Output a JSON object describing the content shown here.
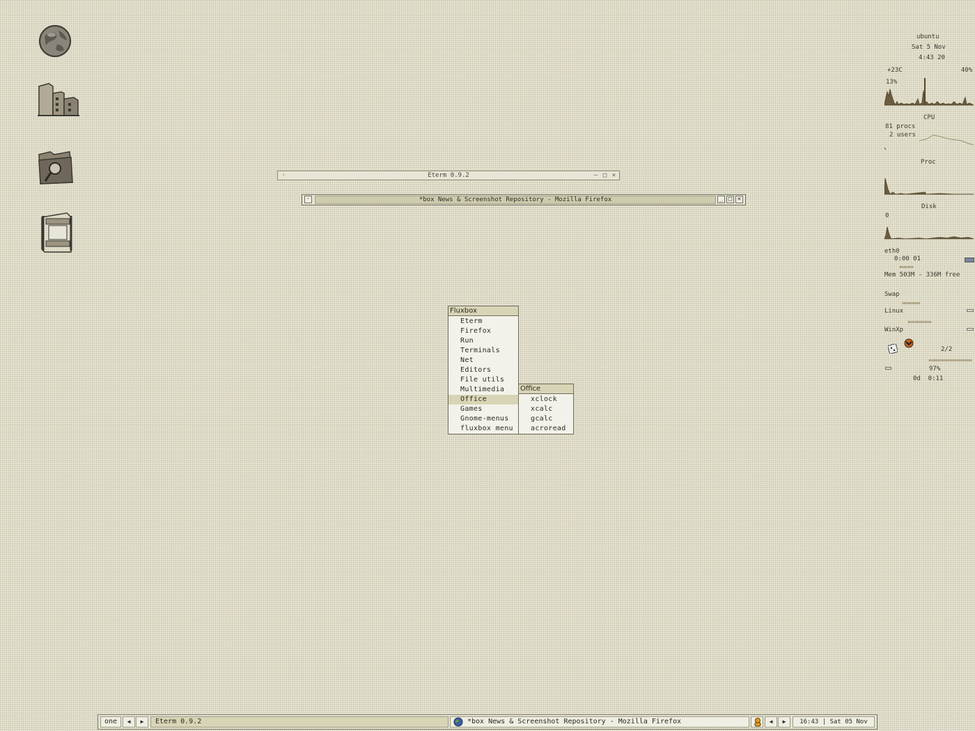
{
  "desktop_icons": [
    {
      "name": "globe-icon"
    },
    {
      "name": "building-icon"
    },
    {
      "name": "folder-search-icon"
    },
    {
      "name": "film-icon"
    }
  ],
  "eterm_window": {
    "title": "Eterm 0.9.2"
  },
  "firefox_window": {
    "title": "*box News & Screenshot Repository - Mozilla Firefox"
  },
  "fluxbox_menu": {
    "title": "Fluxbox",
    "items": [
      "Eterm",
      "Firefox",
      "Run",
      "Terminals",
      "Net",
      "Editors",
      "File utils",
      "Multimedia",
      "Office",
      "Games",
      "Gnome-menus",
      "fluxbox menu"
    ],
    "selected": "Office"
  },
  "office_menu": {
    "title": "Office",
    "items": [
      "xclock",
      "xcalc",
      "gcalc",
      "acroread"
    ]
  },
  "conky": {
    "hostname": "ubuntu",
    "date": "Sat 5 Nov",
    "time": "4:43 20",
    "temp": "+23C",
    "fan": "40%",
    "cpu_pct": "13%",
    "cpu_label": "CPU",
    "procs": "81 procs",
    "users": "2 users",
    "proc_label": "Proc",
    "disk_label": "Disk",
    "disk_val": "0",
    "net_label": "eth0",
    "net_time": "0:00 01",
    "mem": "Mem 503M - 336M free",
    "swap_label": "Swap",
    "linux_label": "Linux",
    "winxp_label": "WinXp",
    "workspace": "2/2",
    "battery": "97%",
    "uptime": "0d  0:11"
  },
  "toolbar": {
    "workspace": "one",
    "task1": "Eterm 0.9.2",
    "task2": "*box News & Screenshot Repository - Mozilla Firefox",
    "clock": "16:43 | Sat 05 Nov"
  }
}
